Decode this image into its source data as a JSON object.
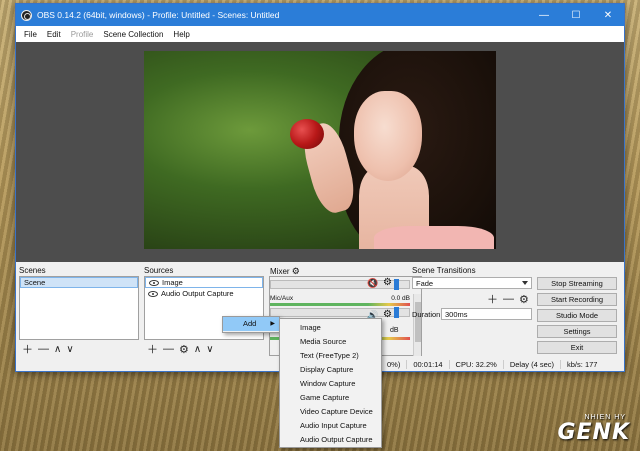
{
  "window": {
    "title": "OBS 0.14.2 (64bit, windows) - Profile: Untitled - Scenes: Untitled",
    "minimize": "—",
    "maximize": "☐",
    "close": "✕"
  },
  "menu": [
    "File",
    "Edit",
    "Profile",
    "Scene Collection",
    "Help"
  ],
  "scenes": {
    "label": "Scenes",
    "items": [
      "Scene"
    ]
  },
  "sources": {
    "label": "Sources",
    "items": [
      "Image",
      "Audio Output Capture"
    ]
  },
  "mixer": {
    "label": "Mixer",
    "tracks": [
      {
        "name": "",
        "db": ""
      },
      {
        "name": "Mic/Aux",
        "db": "0.0 dB"
      }
    ],
    "partial_db": "dB"
  },
  "transitions": {
    "label": "Scene Transitions",
    "selected": "Fade",
    "duration_label": "Duration",
    "duration_value": "300ms"
  },
  "controls": {
    "stop_streaming": "Stop Streaming",
    "start_recording": "Start Recording",
    "studio_mode": "Studio Mode",
    "settings": "Settings",
    "exit": "Exit"
  },
  "statusbar": {
    "drop": "0%)",
    "time": "00:01:14",
    "cpu": "CPU: 32.2%",
    "delay": "Delay (4 sec)",
    "kbps": "kb/s: 177"
  },
  "context_menu": {
    "add_label": "Add",
    "items": [
      "Image",
      "Media Source",
      "Text (FreeType 2)",
      "Display Capture",
      "Window Capture",
      "Game Capture",
      "Video Capture Device",
      "Audio Input Capture",
      "Audio Output Capture"
    ]
  },
  "watermark": {
    "brand": "GENK",
    "sub": "NHIEN HY"
  },
  "colors": {
    "titlebar": "#2b7dd8",
    "selection": "#cfe3f7",
    "context_highlight": "#91c9f7",
    "volume_knob": "#2a7bd6",
    "mute_red": "#d62020"
  }
}
